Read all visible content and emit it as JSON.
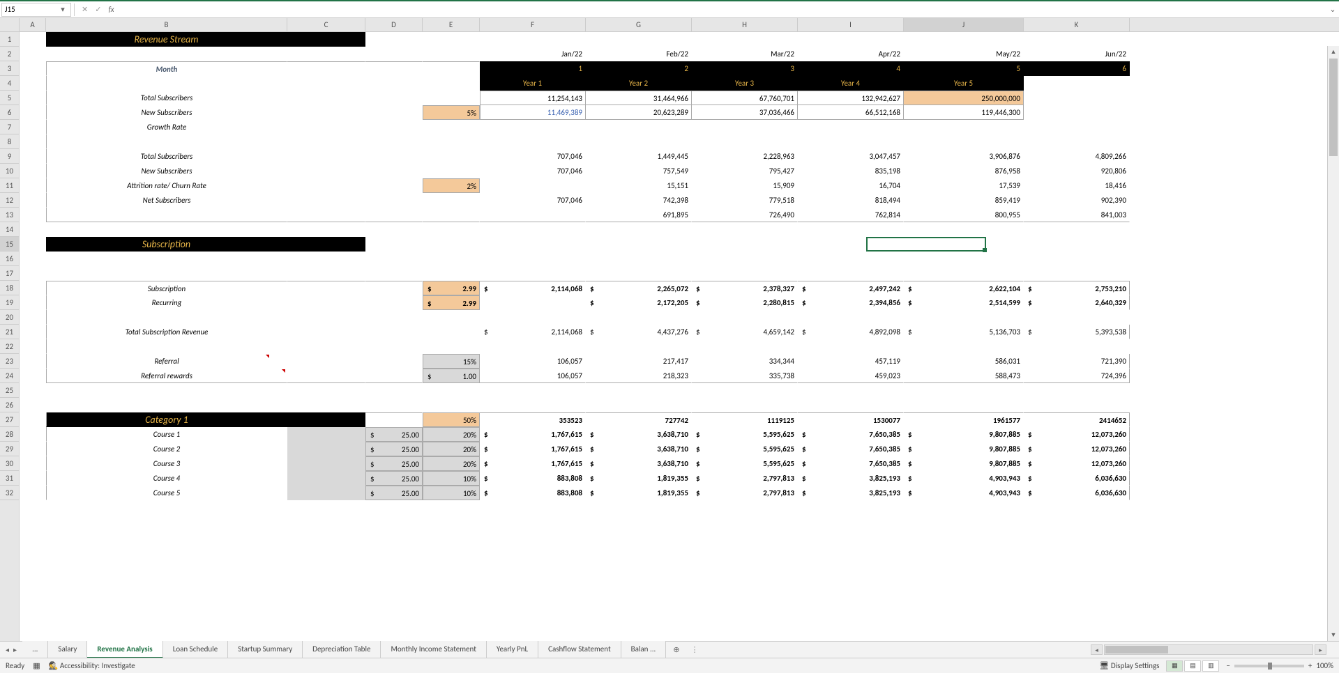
{
  "name_box": "J15",
  "col_headers": [
    "A",
    "B",
    "C",
    "D",
    "E",
    "F",
    "G",
    "H",
    "I",
    "J",
    "K"
  ],
  "row_headers": [
    1,
    2,
    3,
    4,
    5,
    6,
    7,
    8,
    9,
    10,
    11,
    12,
    13,
    14,
    15,
    16,
    17,
    18,
    19,
    20,
    21,
    22,
    23,
    24,
    25,
    26,
    27,
    28,
    29,
    30,
    31,
    32
  ],
  "sections": {
    "revenue_stream": "Revenue Stream",
    "subscription": "Subscription",
    "category1": "Category 1"
  },
  "month_label": "Month",
  "months_header": [
    "Jan/22",
    "Feb/22",
    "Mar/22",
    "Apr/22",
    "May/22",
    "Jun/22"
  ],
  "month_numbers": [
    "1",
    "2",
    "3",
    "4",
    "5",
    "6"
  ],
  "years": [
    "Year 1",
    "Year 2",
    "Year 3",
    "Year 4",
    "Year 5"
  ],
  "labels": {
    "total_subs": "Total Subscribers",
    "new_subs": "New Subscribers",
    "growth_rate": "Growth Rate",
    "attrition": "Attrition rate/ Churn Rate",
    "net_subs": "Net Subscribers",
    "subscription": "Subscription",
    "recurring": "Recurring",
    "total_sub_rev": "Total Subscription Revenue",
    "referral": "Referral",
    "referral_rewards": "Referral rewards",
    "course1": "Course 1",
    "course2": "Course 2",
    "course3": "Course 3",
    "course4": "Course 4",
    "course5": "Course 5"
  },
  "params": {
    "growth_pct": "5%",
    "churn_pct": "2%",
    "sub_price": "2.99",
    "rec_price": "2.99",
    "referral_pct": "15%",
    "referral_reward": "1.00",
    "cat1_pct": "50%",
    "course_price": "25.00",
    "c1_pct": "20%",
    "c2_pct": "20%",
    "c3_pct": "20%",
    "c4_pct": "10%",
    "c5_pct": "10%"
  },
  "r5": [
    "11,254,143",
    "31,464,966",
    "67,760,701",
    "132,942,627",
    "250,000,000"
  ],
  "r6": [
    "11,469,389",
    "20,623,289",
    "37,036,466",
    "66,512,168",
    "119,446,300"
  ],
  "r9": [
    "707,046",
    "1,449,445",
    "2,228,963",
    "3,047,457",
    "3,906,876",
    "4,809,266"
  ],
  "r10": [
    "707,046",
    "757,549",
    "795,427",
    "835,198",
    "876,958",
    "920,806"
  ],
  "r11": [
    "",
    "15,151",
    "15,909",
    "16,704",
    "17,539",
    "18,416"
  ],
  "r12": [
    "707,046",
    "742,398",
    "779,518",
    "818,494",
    "859,419",
    "902,390"
  ],
  "r13": [
    "",
    "691,895",
    "726,490",
    "762,814",
    "800,955",
    "841,003"
  ],
  "r18": [
    "2,114,068",
    "2,265,072",
    "2,378,327",
    "2,497,242",
    "2,622,104",
    "2,753,210"
  ],
  "r19": [
    "",
    "2,172,205",
    "2,280,815",
    "2,394,856",
    "2,514,599",
    "2,640,329"
  ],
  "r21": [
    "2,114,068",
    "4,437,276",
    "4,659,142",
    "4,892,098",
    "5,136,703",
    "5,393,538"
  ],
  "r23": [
    "106,057",
    "217,417",
    "334,344",
    "457,119",
    "586,031",
    "721,390"
  ],
  "r24": [
    "106,057",
    "218,323",
    "335,738",
    "459,023",
    "588,473",
    "724,396"
  ],
  "r27": [
    "353523",
    "727742",
    "1119125",
    "1530077",
    "1961577",
    "2414652"
  ],
  "r28": [
    "1,767,615",
    "3,638,710",
    "5,595,625",
    "7,650,385",
    "9,807,885",
    "12,073,260"
  ],
  "r29": [
    "1,767,615",
    "3,638,710",
    "5,595,625",
    "7,650,385",
    "9,807,885",
    "12,073,260"
  ],
  "r30": [
    "1,767,615",
    "3,638,710",
    "5,595,625",
    "7,650,385",
    "9,807,885",
    "12,073,260"
  ],
  "r31": [
    "883,808",
    "1,819,355",
    "2,797,813",
    "3,825,193",
    "4,903,943",
    "6,036,630"
  ],
  "r32": [
    "883,808",
    "1,819,355",
    "2,797,813",
    "3,825,193",
    "4,903,943",
    "6,036,630"
  ],
  "tabs": [
    "...",
    "Salary",
    "Revenue Analysis",
    "Loan Schedule",
    "Startup Summary",
    "Depreciation Table",
    "Monthly Income Statement",
    "Yearly PnL",
    "Cashflow Statement",
    "Balan ..."
  ],
  "active_tab": "Revenue Analysis",
  "status": {
    "ready": "Ready",
    "accessibility": "Accessibility: Investigate",
    "display_settings": "Display Settings",
    "zoom": "100%"
  }
}
